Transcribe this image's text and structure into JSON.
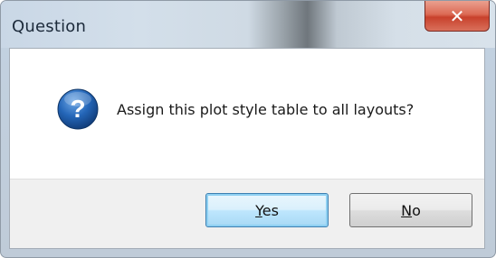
{
  "window": {
    "title": "Question",
    "close_glyph": "✕"
  },
  "dialog": {
    "icon": "question-icon",
    "icon_glyph": "?",
    "message": "Assign this plot style table to all layouts?"
  },
  "buttons": {
    "yes_label": "Yes",
    "no_label": "No"
  },
  "colors": {
    "icon_blue": "#1f5fa8",
    "close_red": "#c8412c",
    "default_button_border": "#3c7fb1"
  }
}
